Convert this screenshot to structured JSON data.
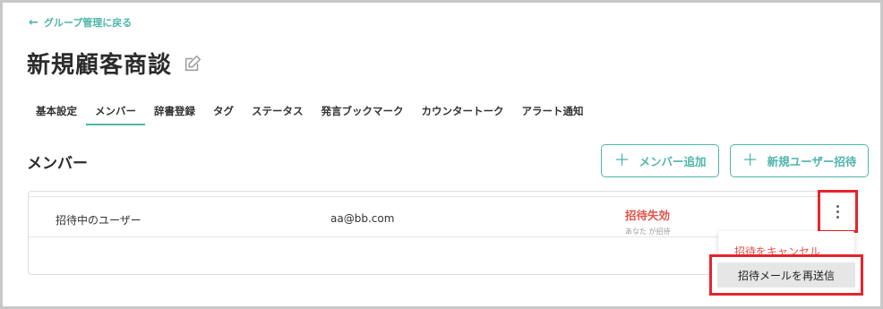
{
  "nav": {
    "back_label": "グループ管理に戻る"
  },
  "page": {
    "title": "新規顧客商談"
  },
  "tabs": [
    {
      "label": "基本設定"
    },
    {
      "label": "メンバー"
    },
    {
      "label": "辞書登録"
    },
    {
      "label": "タグ"
    },
    {
      "label": "ステータス"
    },
    {
      "label": "発言ブックマーク"
    },
    {
      "label": "カウンタートーク"
    },
    {
      "label": "アラート通知"
    }
  ],
  "active_tab_index": 1,
  "section": {
    "title": "メンバー",
    "add_member_label": "メンバー追加",
    "invite_user_label": "新規ユーザー招待"
  },
  "members": [
    {
      "name": "招待中のユーザー",
      "email": "aa@bb.com",
      "status": "招待失効",
      "status_sub": "あなた が招待"
    }
  ],
  "menu": {
    "cancel_label": "招待をキャンセル",
    "resend_label": "招待メールを再送信"
  },
  "colors": {
    "accent": "#4fb5a9",
    "danger": "#e0544a",
    "highlight_border": "#e8232a"
  }
}
